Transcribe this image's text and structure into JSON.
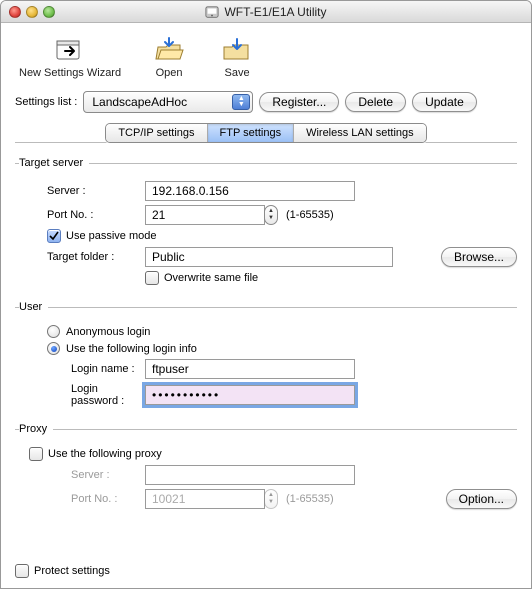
{
  "window": {
    "title": "WFT-E1/E1A Utility"
  },
  "toolbar": {
    "new_wizard": "New Settings Wizard",
    "open": "Open",
    "save": "Save"
  },
  "settings_list": {
    "label": "Settings list :",
    "value": "LandscapeAdHoc",
    "register": "Register...",
    "delete": "Delete",
    "update": "Update"
  },
  "tabs": {
    "tcpip": "TCP/IP settings",
    "ftp": "FTP settings",
    "wlan": "Wireless LAN settings"
  },
  "target_server": {
    "legend": "Target server",
    "server_label": "Server :",
    "server_value": "192.168.0.156",
    "port_label": "Port No. :",
    "port_value": "21",
    "port_hint": "(1-65535)",
    "passive_label": "Use passive mode",
    "folder_label": "Target folder :",
    "folder_value": "Public",
    "browse": "Browse...",
    "overwrite_label": "Overwrite same file"
  },
  "user": {
    "legend": "User",
    "anon_label": "Anonymous login",
    "use_login_label": "Use the following login info",
    "login_name_label": "Login name :",
    "login_name_value": "ftpuser",
    "login_pw_label": "Login password :",
    "login_pw_mask": "•••••••••••"
  },
  "proxy": {
    "legend": "Proxy",
    "use_label": "Use the following proxy",
    "server_label": "Server :",
    "server_value": "",
    "port_label": "Port No. :",
    "port_value": "10021",
    "port_hint": "(1-65535)",
    "option": "Option..."
  },
  "footer": {
    "protect": "Protect settings"
  }
}
